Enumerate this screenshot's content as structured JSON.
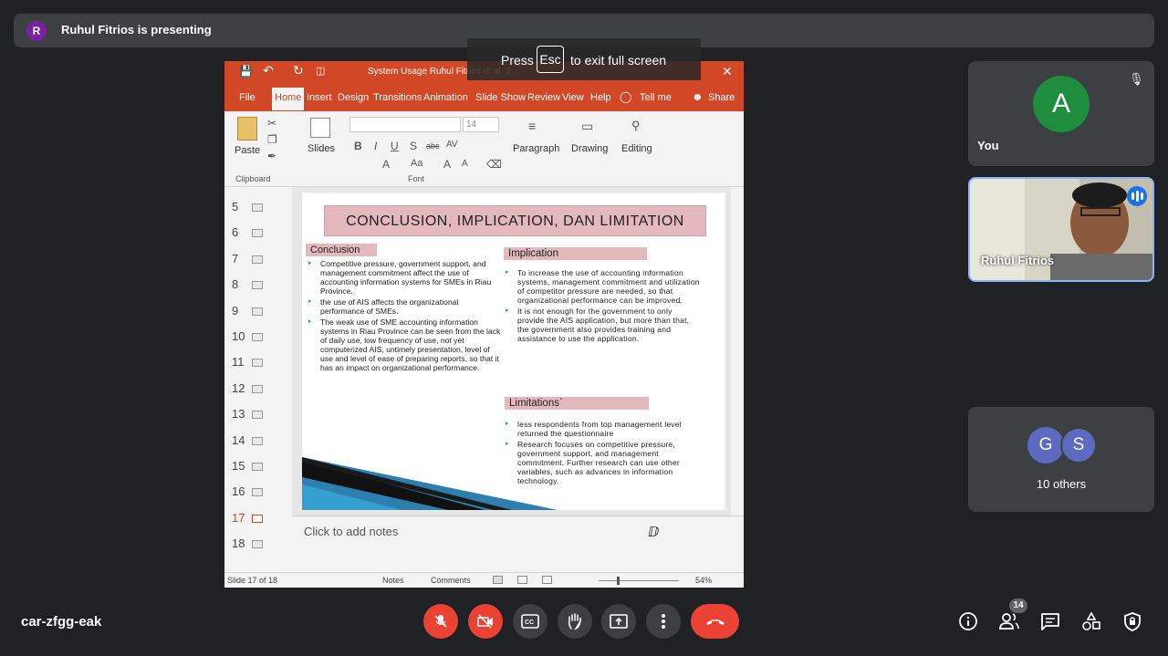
{
  "presenting": {
    "avatar_letter": "R",
    "text": "Ruhul Fitrios is presenting"
  },
  "fullscreen_msg": {
    "press": "Press",
    "key": "Esc",
    "rest": "to exit full screen"
  },
  "ppt": {
    "window_title": "System Usage Ruhul Fitrios et al. 2...",
    "tabs": [
      "File",
      "Home",
      "Insert",
      "Design",
      "Transitions",
      "Animation",
      "Slide Show",
      "Review",
      "View",
      "Help",
      "Tell me",
      "Share"
    ],
    "ribbon": {
      "paste": "Paste",
      "clipboard": "Clipboard",
      "slides": "Slides",
      "font": "Font",
      "font_size": "14",
      "paragraph": "Paragraph",
      "drawing": "Drawing",
      "editing": "Editing"
    },
    "thumbnails": [
      "5",
      "6",
      "7",
      "8",
      "9",
      "10",
      "11",
      "12",
      "13",
      "14",
      "15",
      "16",
      "17",
      "18"
    ],
    "current_slide": "17",
    "slide": {
      "title": "CONCLUSION, IMPLICATION, DAN LIMITATION",
      "conclusion_head": "Conclusion",
      "conclusion_items": [
        "Competitive pressure, government support, and management commitment affect the use of accounting information systems for SMEs in Riau Province.",
        "the use of AIS affects the organizational performance of SMEs.",
        "The weak use of SME accounting information systems in Riau Province can be seen from the lack of daily use, low frequency of use, not yet computerized AIS, untimely presentation, level of use and level of ease of preparing reports, so that it has an impact on organizational performance."
      ],
      "implication_head": "Implication",
      "implication_items": [
        "To increase the use of accounting information systems, management commitment and utilization of competitor pressure are needed, so that organizational performance can be improved.",
        "It is not enough for the government to only provide the AIS application, but more than that, the government also provides training and assistance to use the application."
      ],
      "limitations_head": "Limitations`",
      "limitations_items": [
        "less respondents from top management level returned the questionnaire",
        "Research focuses on competitive pressure, government support, and management commitment. Further research can use other variables, such as advances in information technology."
      ]
    },
    "notes_placeholder": "Click to add notes",
    "status": {
      "slide_of": "Slide 17 of 18",
      "notes": "Notes",
      "comments": "Comments",
      "zoom": "54%"
    }
  },
  "participants": {
    "you": {
      "letter": "A",
      "name": "You",
      "color": "#1e8e3e"
    },
    "ruhul": {
      "name": "Ruhul Fitrios"
    },
    "others": {
      "g": "G",
      "s": "S",
      "label": "10 others"
    }
  },
  "bottom": {
    "meeting_code": "car-zfgg-eak",
    "people_count": "14"
  }
}
